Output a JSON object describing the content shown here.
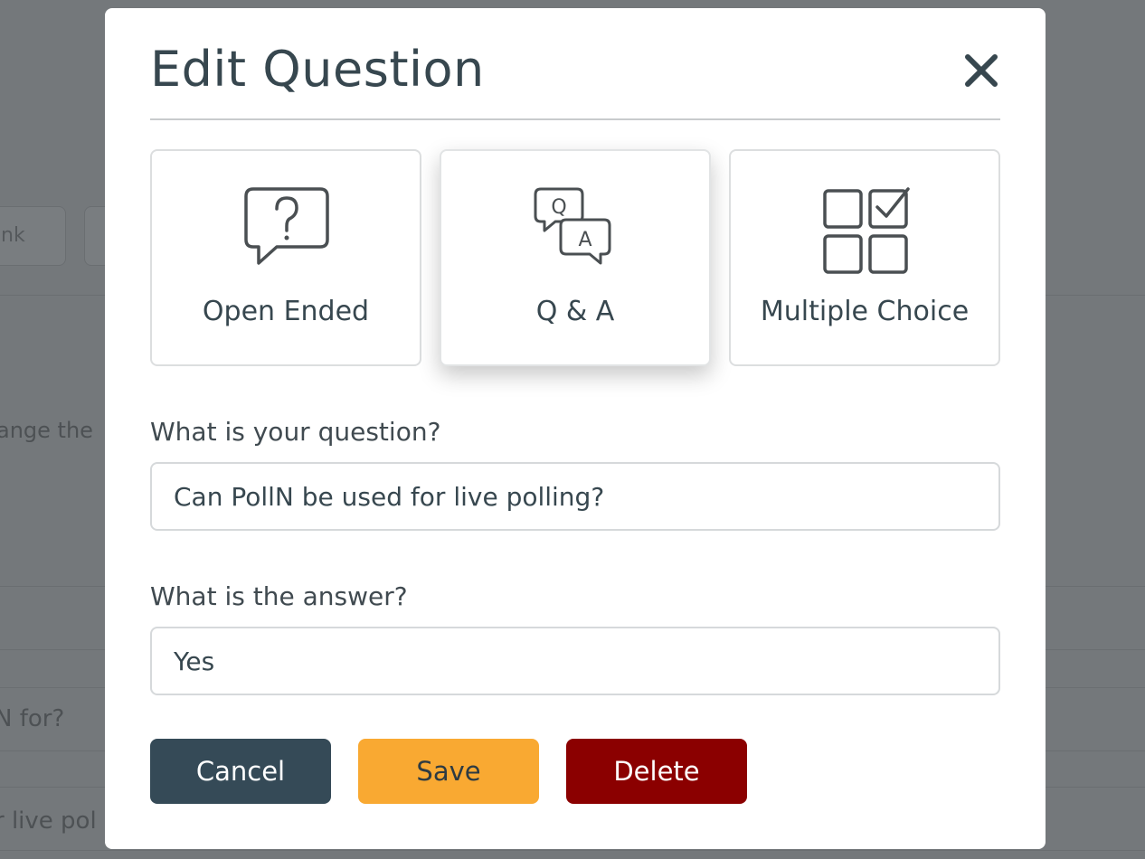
{
  "background": {
    "button_1_label": "nk",
    "text_1": "ange the",
    "text_2": "N for?",
    "text_3": "r live pol"
  },
  "modal": {
    "title": "Edit Question",
    "close_icon": "close-icon",
    "question_types": [
      {
        "label": "Open Ended",
        "icon": "question-bubble-icon",
        "selected": false
      },
      {
        "label": "Q & A",
        "icon": "qa-bubbles-icon",
        "selected": true
      },
      {
        "label": "Multiple Choice",
        "icon": "checkbox-grid-icon",
        "selected": false
      }
    ],
    "question_label": "What is your question?",
    "question_value": "Can PollN be used for live polling?",
    "answer_label": "What is the answer?",
    "answer_value": "Yes",
    "buttons": {
      "cancel": "Cancel",
      "save": "Save",
      "delete": "Delete"
    }
  },
  "colors": {
    "title_text": "#37474f",
    "cancel_bg": "#354a57",
    "save_bg": "#f9a932",
    "delete_bg": "#8b0000",
    "overlay": "#74787b"
  }
}
